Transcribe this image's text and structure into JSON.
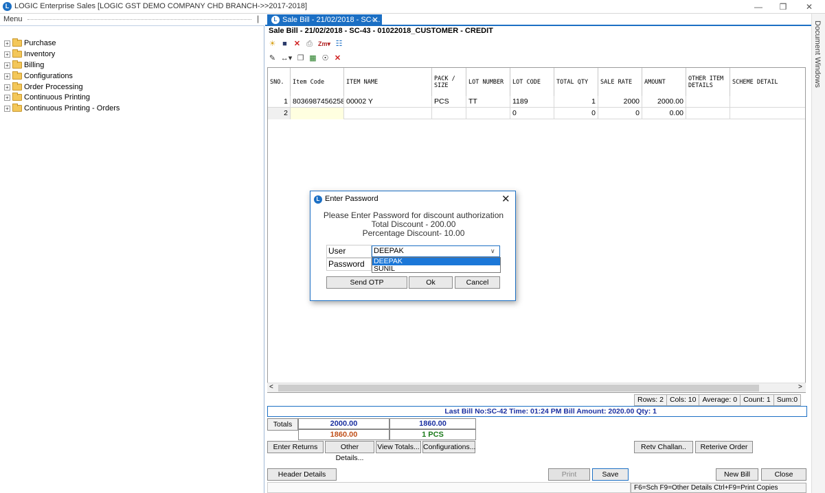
{
  "window": {
    "title": "LOGIC Enterprise Sales  [LOGIC GST DEMO COMPANY CHD BRANCH->>2017-2018]",
    "logo": "logic-logo-icon",
    "minimize": "—",
    "restore": "❒",
    "close": "✕"
  },
  "menu": {
    "header": "Menu",
    "pin": "❘",
    "items": [
      {
        "label": "Purchase"
      },
      {
        "label": "Inventory"
      },
      {
        "label": "Billing"
      },
      {
        "label": "Configurations"
      },
      {
        "label": "Order Processing"
      },
      {
        "label": "Continuous Printing"
      },
      {
        "label": "Continuous Printing - Orders"
      }
    ]
  },
  "dock": {
    "label": "Document Windows"
  },
  "tab": {
    "label": "Sale Bill - 21/02/2018 - SC-...",
    "close": "✕"
  },
  "bill": {
    "title": "Sale Bill - 21/02/2018 - SC-43 - 01022018_CUSTOMER - CREDIT"
  },
  "toolbar1": [
    {
      "name": "new-icon",
      "glyph": "☀"
    },
    {
      "name": "save-icon",
      "glyph": "■"
    },
    {
      "name": "delete-icon",
      "glyph": "✕"
    },
    {
      "name": "print-icon",
      "glyph": "⎙"
    },
    {
      "name": "zoom-icon",
      "glyph": "Zm▾"
    },
    {
      "name": "network-icon",
      "glyph": "☷"
    }
  ],
  "toolbar2": [
    {
      "name": "edit-icon",
      "glyph": "✎"
    },
    {
      "name": "move-icon",
      "glyph": "↔▾"
    },
    {
      "name": "copy-icon",
      "glyph": "❐"
    },
    {
      "name": "excel-icon",
      "glyph": "▦"
    },
    {
      "name": "find-icon",
      "glyph": "☉"
    },
    {
      "name": "close-red-icon",
      "glyph": "✕"
    }
  ],
  "grid": {
    "headers": [
      "SNO.",
      "Item Code",
      "ITEM NAME",
      "PACK / SIZE",
      "LOT NUMBER",
      "LOT CODE",
      "TOTAL QTY",
      "SALE RATE",
      "AMOUNT",
      "OTHER ITEM DETAILS",
      "SCHEME DETAIL"
    ],
    "rows": [
      [
        "1",
        "8036987456258",
        "00002 Y",
        "PCS",
        "TT",
        "1189",
        "1",
        "2000",
        "2000.00",
        "",
        ""
      ],
      [
        "2",
        "",
        "",
        "",
        "",
        "0",
        "0",
        "0",
        "0.00",
        "",
        ""
      ]
    ]
  },
  "status": {
    "rows": "Rows: 2",
    "cols": "Cols: 10",
    "average": "Average: 0",
    "count": "Count: 1",
    "sum": "Sum:0"
  },
  "lastbill": "Last Bill No:SC-42  Time: 01:24 PM   Bill Amount: 2020.00  Qty: 1",
  "totals": {
    "label": "Totals",
    "a": "2000.00",
    "b": "1860.00",
    "c": "1860.00",
    "d": "1 PCS",
    "colors": {
      "blue": "#1a2fa0",
      "orange": "#c0501a",
      "green": "#1b7a1b"
    }
  },
  "buttons": {
    "enter_returns": "Enter Returns",
    "other_details": "Other Details...",
    "view_totals": "View Totals...",
    "configurations": "Configurations...",
    "retv_challan": "Retv Challan..",
    "retrieve_order": "Reterive Order",
    "header_details": "Header Details",
    "print": "Print",
    "save": "Save",
    "new_bill": "New Bill",
    "close": "Close"
  },
  "footer": "F6=Sch  F9=Other Details  Ctrl+F9=Print Copies",
  "dialog": {
    "title": "Enter Password",
    "close": "✕",
    "line1": "Please Enter Password for discount authorization",
    "line2": "Total Discount - 200.00",
    "line3": "Percentage Discount- 10.00",
    "user_label": "User",
    "password_label": "Password",
    "user_value": "DEEPAK",
    "options": [
      "DEEPAK",
      "SUNIL"
    ],
    "send_otp": "Send OTP",
    "ok": "Ok",
    "cancel": "Cancel"
  },
  "accent": "#1b6fc4"
}
